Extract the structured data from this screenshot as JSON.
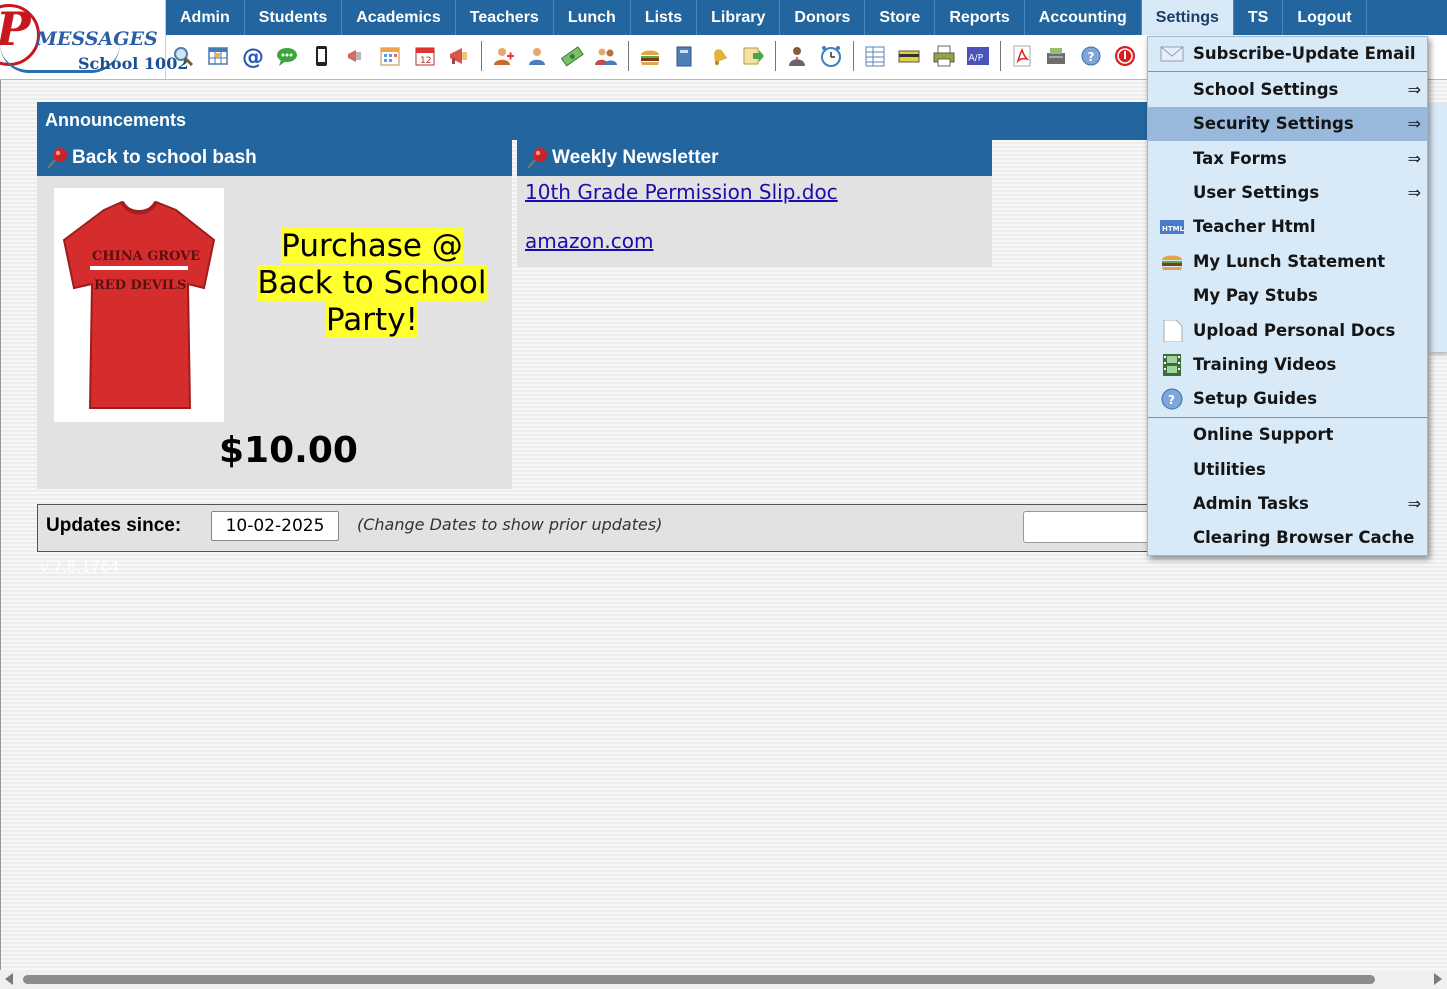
{
  "header": {
    "logo_text": "MESSAGES",
    "school_name": "School 1002"
  },
  "nav": {
    "items": [
      "Admin",
      "Students",
      "Academics",
      "Teachers",
      "Lunch",
      "Lists",
      "Library",
      "Donors",
      "Store",
      "Reports",
      "Accounting",
      "Settings",
      "TS",
      "Logout"
    ],
    "active": "Settings"
  },
  "toolbar_icons": [
    "search-icon",
    "grid-icon",
    "at-sign-icon",
    "chat-icon",
    "phone-icon",
    "megaphone-off-icon",
    "calendar-icon",
    "calendar-day-icon",
    "megaphone-icon",
    "add-user-icon",
    "user-icon",
    "money-icon",
    "users-icon",
    "hamburger-icon",
    "book-icon",
    "bell-icon",
    "export-icon",
    "teacher-icon",
    "clock-icon",
    "spreadsheet-icon",
    "card-icon",
    "printer-icon",
    "ap-icon",
    "pdf-icon",
    "cash-register-icon",
    "help-icon",
    "stop-icon"
  ],
  "announcements": {
    "title": "Announcements",
    "cards": [
      {
        "title": "Back to school bash",
        "shirt_text_1": "CHINA GROVE",
        "shirt_text_2": "RED DEVILS",
        "promo": "Purchase @ Back to School Party!",
        "price": "$10.00"
      },
      {
        "title": "Weekly Newsletter",
        "links": [
          "10th Grade Permission Slip.doc",
          "amazon.com"
        ]
      }
    ]
  },
  "updates": {
    "label": "Updates since:",
    "date": "10-02-2025",
    "hint": "(Change Dates to show prior updates)"
  },
  "version": "v.7.8.1764",
  "settings_menu": {
    "items": [
      {
        "label": "Subscribe-Update Email",
        "icon": "email-icon",
        "arrow": false
      },
      {
        "label": "School Settings",
        "icon": "",
        "arrow": true
      },
      {
        "label": "Security Settings",
        "icon": "",
        "arrow": true,
        "highlighted": true
      },
      {
        "label": "Tax Forms",
        "icon": "",
        "arrow": true
      },
      {
        "label": "User Settings",
        "icon": "",
        "arrow": true
      },
      {
        "label": "Teacher Html",
        "icon": "html-icon",
        "arrow": false
      },
      {
        "label": "My Lunch Statement",
        "icon": "hamburger-icon",
        "arrow": false
      },
      {
        "label": "My Pay Stubs",
        "icon": "",
        "arrow": false
      },
      {
        "label": "Upload Personal Docs",
        "icon": "document-icon",
        "arrow": false
      },
      {
        "label": "Training Videos",
        "icon": "film-icon",
        "arrow": false
      },
      {
        "label": "Setup Guides",
        "icon": "help-icon",
        "arrow": false
      },
      {
        "label": "Online Support",
        "icon": "",
        "arrow": false
      },
      {
        "label": "Utilities",
        "icon": "",
        "arrow": false
      },
      {
        "label": "Admin Tasks",
        "icon": "",
        "arrow": true
      },
      {
        "label": "Clearing Browser Cache",
        "icon": "",
        "arrow": false
      }
    ],
    "arrow_glyph": "⇒"
  },
  "colors": {
    "nav_blue": "#23669f",
    "menu_bg": "#d8e9f7",
    "menu_highlight": "#98b9db",
    "promo_yellow": "#ffff2e",
    "link": "#1a0dab"
  }
}
